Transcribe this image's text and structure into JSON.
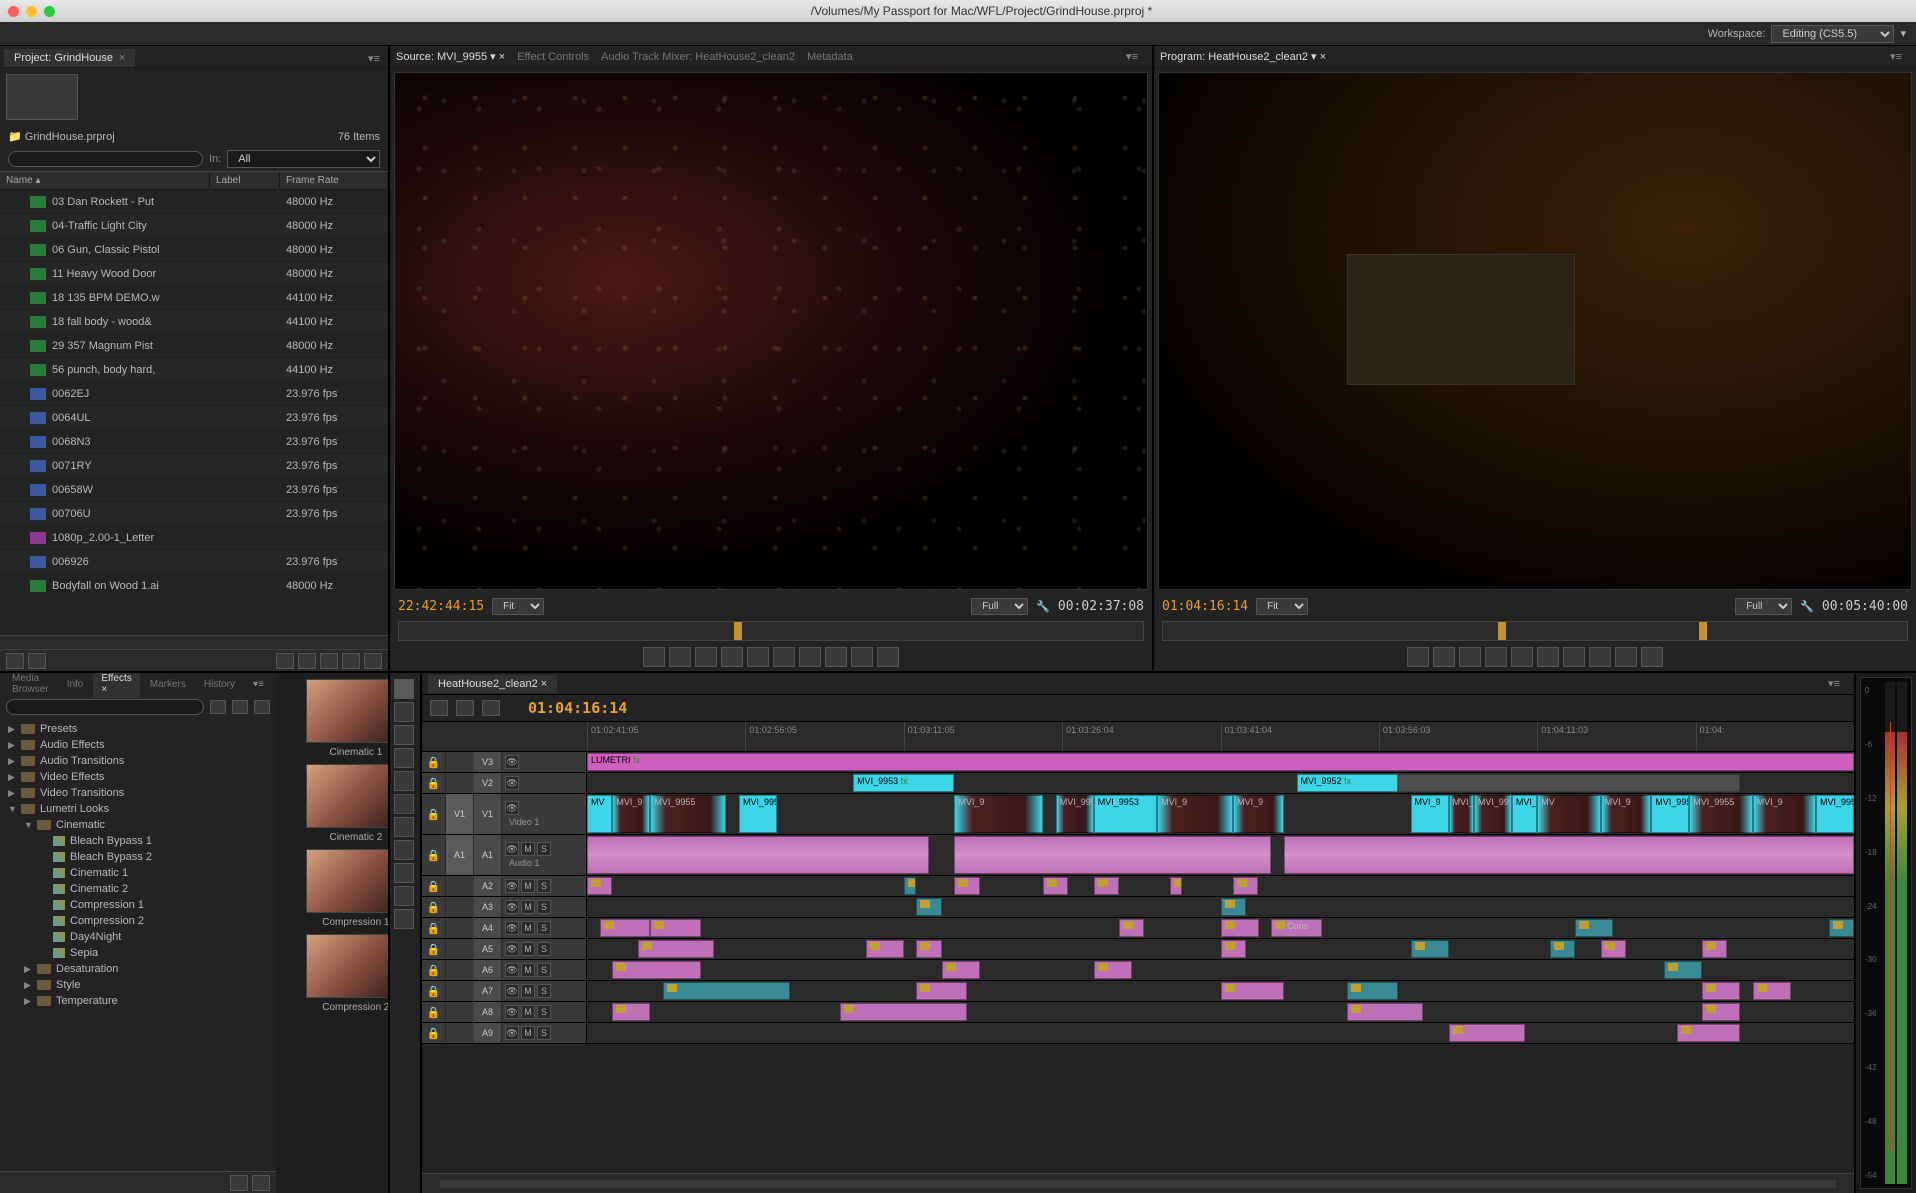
{
  "titlebar": {
    "title": "/Volumes/My Passport for Mac/WFL/Project/GrindHouse.prproj *"
  },
  "workspace": {
    "label": "Workspace:",
    "value": "Editing (CS5.5)"
  },
  "project": {
    "tab": "Project: GrindHouse",
    "bin": "GrindHouse.prproj",
    "item_count": "76 Items",
    "in_label": "In:",
    "in_value": "All",
    "columns": {
      "name": "Name",
      "label": "Label",
      "framerate": "Frame Rate"
    },
    "items": [
      {
        "name": "03 Dan Rockett - Put",
        "type": "audio",
        "label": "pink",
        "rate": "48000 Hz"
      },
      {
        "name": "04-Traffic Light City",
        "type": "audio",
        "label": "pink",
        "rate": "48000 Hz"
      },
      {
        "name": "06 Gun, Classic Pistol",
        "type": "audio",
        "label": "pink",
        "rate": "48000 Hz"
      },
      {
        "name": "11 Heavy Wood Door",
        "type": "audio",
        "label": "pink",
        "rate": "48000 Hz"
      },
      {
        "name": "18 135 BPM DEMO.w",
        "type": "audio",
        "label": "pink",
        "rate": "44100 Hz"
      },
      {
        "name": "18 fall body - wood&",
        "type": "audio",
        "label": "pink",
        "rate": "44100 Hz"
      },
      {
        "name": "29 357 Magnum Pist",
        "type": "audio",
        "label": "pink",
        "rate": "48000 Hz"
      },
      {
        "name": "56 punch, body hard,",
        "type": "audio",
        "label": "pink",
        "rate": "44100 Hz"
      },
      {
        "name": "0062EJ",
        "type": "video",
        "label": "cyan",
        "rate": "23.976 fps"
      },
      {
        "name": "0064UL",
        "type": "video",
        "label": "cyan",
        "rate": "23.976 fps"
      },
      {
        "name": "0068N3",
        "type": "video",
        "label": "cyan",
        "rate": "23.976 fps"
      },
      {
        "name": "0071RY",
        "type": "video",
        "label": "cyan",
        "rate": "23.976 fps"
      },
      {
        "name": "00658W",
        "type": "video",
        "label": "cyan",
        "rate": "23.976 fps"
      },
      {
        "name": "00706U",
        "type": "video",
        "label": "cyan",
        "rate": "23.976 fps"
      },
      {
        "name": "1080p_2.00-1_Letter",
        "type": "still",
        "label": "pink",
        "rate": ""
      },
      {
        "name": "006926",
        "type": "video",
        "label": "cyan",
        "rate": "23.976 fps"
      },
      {
        "name": "Bodyfall on Wood 1.ai",
        "type": "audio",
        "label": "pink",
        "rate": "48000 Hz"
      }
    ]
  },
  "source": {
    "tab": "Source: MVI_9955",
    "tabs_other": [
      "Effect Controls",
      "Audio Track Mixer: HeatHouse2_clean2",
      "Metadata"
    ],
    "tc_left": "22:42:44:15",
    "tc_right": "00:02:37:08",
    "fit": "Fit",
    "full": "Full"
  },
  "program": {
    "tab": "Program: HeatHouse2_clean2",
    "tc_left": "01:04:16:14",
    "tc_right": "00:05:40:00",
    "fit": "Fit",
    "full": "Full"
  },
  "effects": {
    "tabs": [
      "Media Browser",
      "Info",
      "Effects",
      "Markers",
      "History"
    ],
    "active": "Effects",
    "tree": [
      {
        "l": 1,
        "arrow": "▶",
        "name": "Presets",
        "icon": "folder"
      },
      {
        "l": 1,
        "arrow": "▶",
        "name": "Audio Effects",
        "icon": "folder"
      },
      {
        "l": 1,
        "arrow": "▶",
        "name": "Audio Transitions",
        "icon": "folder"
      },
      {
        "l": 1,
        "arrow": "▶",
        "name": "Video Effects",
        "icon": "folder"
      },
      {
        "l": 1,
        "arrow": "▶",
        "name": "Video Transitions",
        "icon": "folder"
      },
      {
        "l": 1,
        "arrow": "▼",
        "name": "Lumetri Looks",
        "icon": "folder"
      },
      {
        "l": 2,
        "arrow": "▼",
        "name": "Cinematic",
        "icon": "folder"
      },
      {
        "l": 3,
        "arrow": "",
        "name": "Bleach Bypass 1",
        "icon": "preset"
      },
      {
        "l": 3,
        "arrow": "",
        "name": "Bleach Bypass 2",
        "icon": "preset"
      },
      {
        "l": 3,
        "arrow": "",
        "name": "Cinematic 1",
        "icon": "preset"
      },
      {
        "l": 3,
        "arrow": "",
        "name": "Cinematic 2",
        "icon": "preset"
      },
      {
        "l": 3,
        "arrow": "",
        "name": "Compression 1",
        "icon": "preset"
      },
      {
        "l": 3,
        "arrow": "",
        "name": "Compression 2",
        "icon": "preset"
      },
      {
        "l": 3,
        "arrow": "",
        "name": "Day4Night",
        "icon": "preset"
      },
      {
        "l": 3,
        "arrow": "",
        "name": "Sepia",
        "icon": "preset"
      },
      {
        "l": 2,
        "arrow": "▶",
        "name": "Desaturation",
        "icon": "folder"
      },
      {
        "l": 2,
        "arrow": "▶",
        "name": "Style",
        "icon": "folder"
      },
      {
        "l": 2,
        "arrow": "▶",
        "name": "Temperature",
        "icon": "folder"
      }
    ],
    "looks": [
      "Cinematic 1",
      "Cinematic 2",
      "Compression 1",
      "Compression 2"
    ]
  },
  "timeline": {
    "tab": "HeatHouse2_clean2",
    "tc": "01:04:16:14",
    "ruler": [
      "01:02:41:05",
      "01:02:56:05",
      "01:03:11:05",
      "01:03:26:04",
      "01:03:41:04",
      "01:03:56:03",
      "01:04:11:03",
      "01:04:"
    ],
    "v3_clip": "LUMETRI",
    "v2_clips": [
      "MVI_9953",
      "MVI_9952"
    ],
    "v1_label": "Video 1",
    "a1_label": "Audio 1",
    "v1_clips": [
      "MV",
      "MVI_9",
      "MVI_9955",
      "MVI_9955",
      "MVI_9",
      "MVI_995",
      "MVI_9953",
      "MVI_9",
      "MVI_9",
      "MVI_9",
      "MVI_9955",
      "MVI_99",
      "MVI_99"
    ],
    "cons": "Cons",
    "tracks_v": [
      "V3",
      "V2",
      "V1"
    ],
    "tracks_a": [
      "A1",
      "A2",
      "A3",
      "A4",
      "A5",
      "A6",
      "A7",
      "A8",
      "A9"
    ],
    "tog_m": "M",
    "tog_s": "S",
    "meter_scale": [
      "0",
      "-6",
      "-12",
      "-18",
      "-24",
      "-30",
      "-36",
      "-42",
      "-48",
      "-54"
    ]
  }
}
